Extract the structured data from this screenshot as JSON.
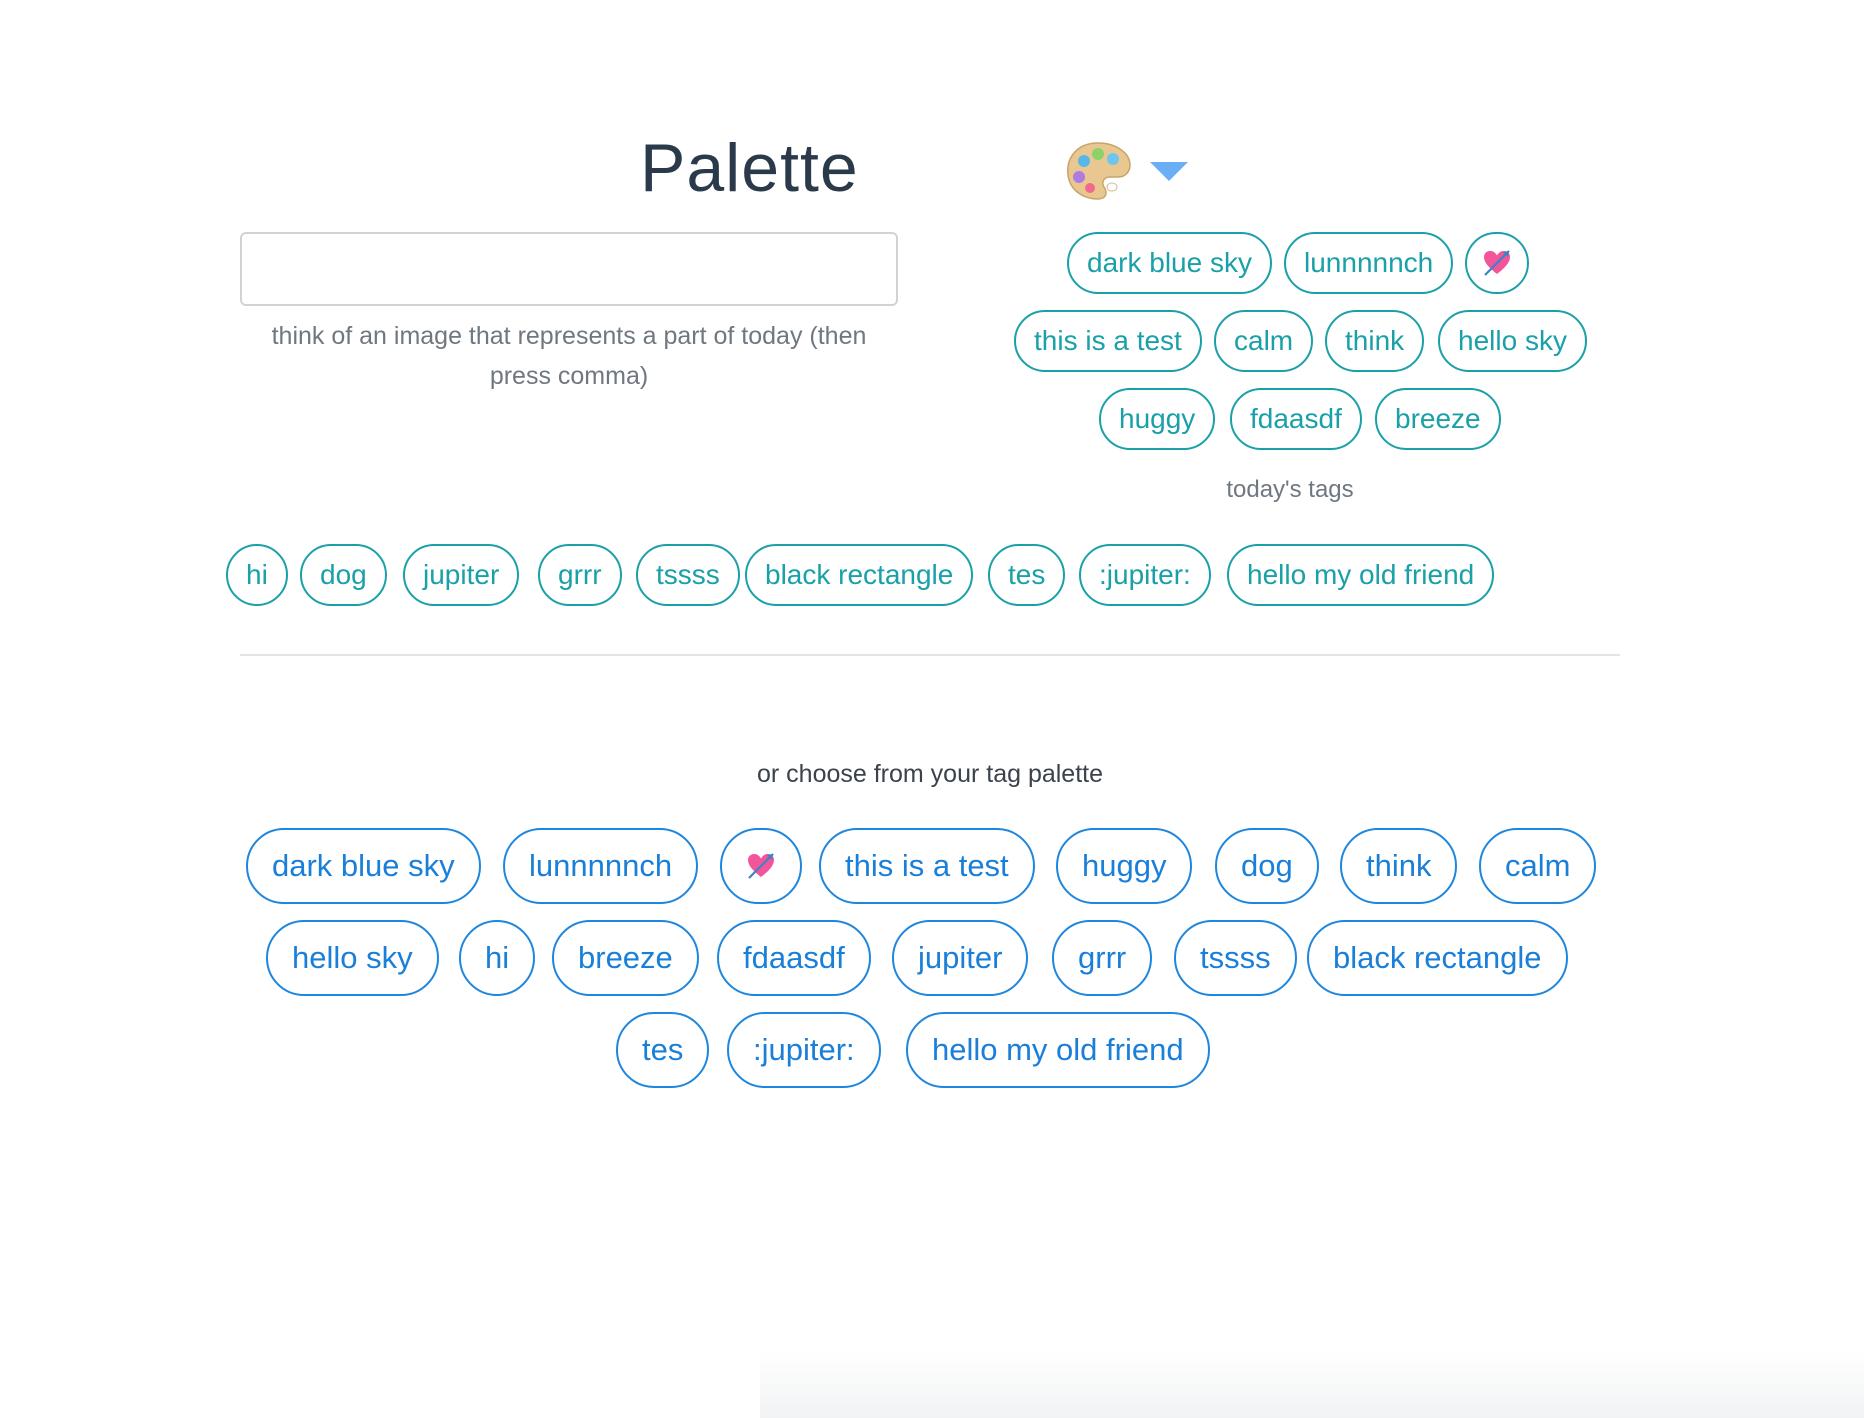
{
  "header": {
    "title": "Palette",
    "palette_icon": "artist-palette-icon",
    "caret_icon": "caret-down-icon",
    "caret_color": "#6aaef5"
  },
  "input": {
    "value": "",
    "placeholder": "",
    "hint": "think of an image that represents a part of today (then press comma)"
  },
  "today": {
    "label": "today's tags",
    "color": "#1aa0a8",
    "tags": [
      {
        "label": "dark blue sky"
      },
      {
        "label": "lunnnnnch"
      },
      {
        "label": "",
        "icon": "heart-with-arrow-icon"
      },
      {
        "label": "this is a test"
      },
      {
        "label": "calm"
      },
      {
        "label": "think"
      },
      {
        "label": "hello sky"
      },
      {
        "label": "huggy"
      },
      {
        "label": "fdaasdf"
      },
      {
        "label": "breeze"
      },
      {
        "label": "hi"
      },
      {
        "label": "dog"
      },
      {
        "label": "jupiter"
      },
      {
        "label": "grrr"
      },
      {
        "label": "tssss"
      },
      {
        "label": "black rectangle"
      },
      {
        "label": "tes"
      },
      {
        "label": ":jupiter:"
      },
      {
        "label": "hello my old friend"
      }
    ]
  },
  "palette": {
    "label": "or choose from your tag palette",
    "color": "#1f86dd",
    "tags": [
      {
        "label": "dark blue sky"
      },
      {
        "label": "lunnnnnch"
      },
      {
        "label": "",
        "icon": "heart-with-arrow-icon"
      },
      {
        "label": "this is a test"
      },
      {
        "label": "huggy"
      },
      {
        "label": "dog"
      },
      {
        "label": "think"
      },
      {
        "label": "calm"
      },
      {
        "label": "hello sky"
      },
      {
        "label": "hi"
      },
      {
        "label": "breeze"
      },
      {
        "label": "fdaasdf"
      },
      {
        "label": "jupiter"
      },
      {
        "label": "grrr"
      },
      {
        "label": "tssss"
      },
      {
        "label": "black rectangle"
      },
      {
        "label": "tes"
      },
      {
        "label": ":jupiter:"
      },
      {
        "label": "hello my old friend"
      }
    ]
  }
}
